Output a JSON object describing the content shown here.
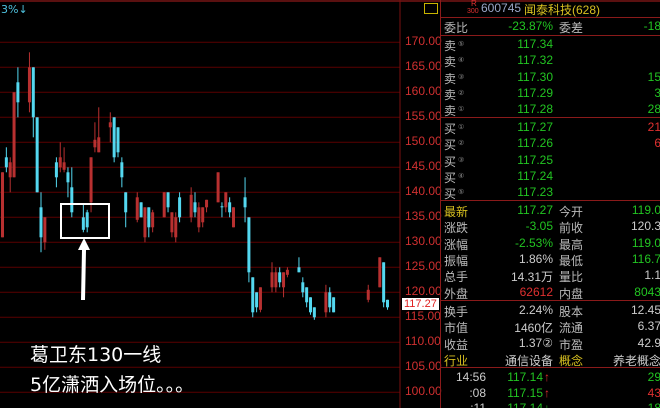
{
  "chart_header": {
    "indicator": "3%↓"
  },
  "price_axis": {
    "labels": [
      "170.00",
      "165.00",
      "160.00",
      "155.00",
      "150.00",
      "145.00",
      "140.00",
      "135.00",
      "130.00",
      "125.00",
      "120.00",
      "115.00",
      "110.00",
      "105.00",
      "100.00"
    ],
    "last_price": "117.27"
  },
  "annotation": {
    "line1": "葛卫东130一线",
    "line2": "5亿潇洒入场位。。。"
  },
  "colors": {
    "up": "#b83030",
    "down": "#54d8f0",
    "grid": "#5a0000"
  },
  "chart_data": {
    "type": "candlestick",
    "ylim": [
      100,
      175
    ],
    "ohlc_format": "[open,close,high,low]",
    "candles": [
      [
        131,
        144,
        144,
        131
      ],
      [
        147,
        145,
        149,
        144
      ],
      [
        143,
        146,
        147,
        140
      ],
      [
        143,
        160,
        160,
        143
      ],
      [
        162,
        158,
        165,
        155
      ],
      null,
      null,
      [
        158,
        165,
        168,
        156
      ],
      [
        165,
        155,
        165,
        151
      ],
      [
        155,
        140,
        155,
        140
      ],
      [
        137,
        131,
        140,
        128
      ],
      [
        130,
        135,
        135,
        128.5
      ],
      null,
      null,
      [
        146,
        143,
        147,
        141
      ],
      [
        145,
        147,
        150,
        144
      ],
      [
        144.5,
        146,
        149,
        144
      ],
      [
        144,
        142,
        145,
        139
      ],
      [
        141,
        136,
        145,
        135
      ],
      null,
      null,
      [
        135,
        132.5,
        137.5,
        132
      ],
      [
        136,
        133,
        136.5,
        132
      ],
      [
        138,
        147,
        147,
        136
      ],
      [
        149,
        150.5,
        154,
        148
      ],
      [
        148,
        151,
        157,
        148
      ],
      null,
      null,
      [
        153,
        154,
        156,
        150
      ],
      [
        155,
        147,
        155,
        146
      ],
      [
        153,
        148,
        153,
        147
      ],
      [
        146,
        143,
        147,
        141
      ],
      [
        140,
        136,
        140,
        133
      ],
      null,
      null,
      [
        134.5,
        139,
        140,
        134
      ],
      [
        138,
        135,
        138,
        135
      ],
      [
        131,
        137,
        137,
        130
      ],
      [
        137,
        133,
        137,
        131
      ],
      [
        133,
        136,
        136.5,
        132
      ],
      null,
      null,
      [
        135,
        140,
        140,
        135
      ],
      [
        140,
        137,
        140,
        136
      ],
      [
        132,
        136,
        136,
        131
      ],
      [
        131,
        135,
        136,
        130
      ],
      [
        139,
        135,
        140,
        134
      ],
      null,
      null,
      [
        135,
        139.5,
        141,
        134
      ],
      [
        138,
        136,
        140,
        135
      ],
      [
        133,
        137,
        138,
        132
      ],
      [
        134,
        137,
        137,
        133
      ],
      [
        137,
        138.5,
        138.5,
        136
      ],
      null,
      null,
      [
        138,
        144,
        144,
        138
      ],
      [
        137.2,
        137,
        138,
        135
      ],
      [
        137,
        140,
        140,
        136
      ],
      [
        138,
        136,
        139,
        135
      ],
      [
        133,
        137,
        137,
        133
      ],
      null,
      null,
      [
        139,
        137,
        143,
        134
      ],
      [
        135,
        124,
        135,
        122
      ],
      [
        123,
        116,
        123,
        115
      ],
      [
        120,
        117,
        120,
        116
      ],
      [
        116.5,
        121,
        121,
        116
      ],
      null,
      null,
      [
        121,
        124,
        126,
        120
      ],
      [
        121,
        124,
        125,
        120
      ],
      [
        124,
        122,
        125,
        121
      ],
      [
        121,
        124,
        124,
        119
      ],
      [
        123.5,
        124.5,
        125,
        123
      ],
      null,
      null,
      [
        125,
        124,
        127,
        124
      ],
      [
        122,
        120,
        123,
        119
      ],
      [
        121,
        118,
        121,
        117
      ],
      [
        119,
        116,
        119,
        115.5
      ],
      [
        117,
        115,
        117,
        114.5
      ],
      null,
      null,
      [
        116,
        120,
        121.5,
        115
      ],
      [
        120,
        117,
        121,
        116
      ],
      [
        119,
        116,
        119,
        116
      ],
      null,
      null,
      null,
      null,
      null,
      null,
      null,
      null,
      [
        118.5,
        120.5,
        121.5,
        118
      ],
      null,
      null,
      [
        121,
        127,
        127,
        121
      ],
      [
        126,
        118,
        126,
        117
      ],
      [
        118.5,
        117,
        118.5,
        116.5
      ]
    ]
  },
  "quote": {
    "header": {
      "badge_top": "R",
      "badge_bottom": "300",
      "code": "600745",
      "name": "闻泰科技(628)"
    },
    "weibi": {
      "label": "委比",
      "value": "-23.87%",
      "label2": "委差",
      "value2": "-18"
    },
    "sell": [
      {
        "label": "卖",
        "idx": "⑤",
        "price": "117.34",
        "vol": ""
      },
      {
        "label": "卖",
        "idx": "④",
        "price": "117.32",
        "vol": ""
      },
      {
        "label": "卖",
        "idx": "③",
        "price": "117.30",
        "vol": "15"
      },
      {
        "label": "卖",
        "idx": "②",
        "price": "117.29",
        "vol": "3"
      },
      {
        "label": "卖",
        "idx": "①",
        "price": "117.28",
        "vol": "28"
      }
    ],
    "buy": [
      {
        "label": "买",
        "idx": "①",
        "price": "117.27",
        "vol": "21"
      },
      {
        "label": "买",
        "idx": "②",
        "price": "117.26",
        "vol": "6"
      },
      {
        "label": "买",
        "idx": "③",
        "price": "117.25",
        "vol": ""
      },
      {
        "label": "买",
        "idx": "④",
        "price": "117.24",
        "vol": ""
      },
      {
        "label": "买",
        "idx": "⑤",
        "price": "117.23",
        "vol": ""
      }
    ],
    "stats": [
      {
        "l1": "最新",
        "v1": "117.27",
        "c1": "g",
        "l2": "今开",
        "v2": "119.0",
        "c2": "g",
        "y": true
      },
      {
        "l1": "涨跌",
        "v1": "-3.05",
        "c1": "g",
        "l2": "前收",
        "v2": "120.3",
        "c2": "w"
      },
      {
        "l1": "涨幅",
        "v1": "-2.53%",
        "c1": "g",
        "l2": "最高",
        "v2": "119.0",
        "c2": "g"
      },
      {
        "l1": "振幅",
        "v1": "1.86%",
        "c1": "w",
        "l2": "最低",
        "v2": "116.7",
        "c2": "g"
      },
      {
        "l1": "总手",
        "v1": "14.31万",
        "c1": "w",
        "l2": "量比",
        "v2": "1.1",
        "c2": "w"
      },
      {
        "l1": "外盘",
        "v1": "62612",
        "c1": "r",
        "l2": "内盘",
        "v2": "8043",
        "c2": "g"
      }
    ],
    "finance": [
      {
        "l1": "换手",
        "v1": "2.24%",
        "l2": "股本",
        "v2": "12.45"
      },
      {
        "l1": "市值",
        "v1": "1460亿",
        "l2": "流通",
        "v2": "6.37"
      },
      {
        "l1": "收益",
        "v1": "1.37②",
        "l2": "市盈",
        "v2": "42.9"
      },
      {
        "l1": "行业",
        "v1": "通信设备",
        "l2": "概念",
        "v2": "养老概念"
      }
    ],
    "ticks": [
      {
        "time": "14:56",
        "price": "117.14",
        "arrow": "↑",
        "ac": "r",
        "vol": "29",
        "vc": "g"
      },
      {
        "time": ":08",
        "price": "117.15",
        "arrow": "↑",
        "ac": "r",
        "vol": "43",
        "vc": "r"
      },
      {
        "time": ":11",
        "price": "117.14",
        "arrow": "↓",
        "ac": "g",
        "vol": "18",
        "vc": "g"
      }
    ]
  }
}
